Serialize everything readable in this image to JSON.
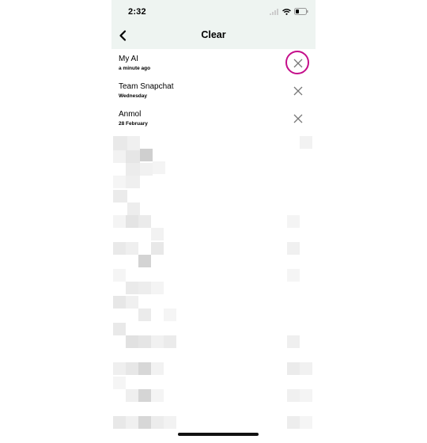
{
  "status_bar": {
    "time": "2:32"
  },
  "header": {
    "title": "Clear"
  },
  "chats": [
    {
      "name": "My AI",
      "time": "a minute ago"
    },
    {
      "name": "Team Snapchat",
      "time": "Wednesday"
    },
    {
      "name": "Anmol",
      "time": "28 February"
    }
  ],
  "colors": {
    "header_bg": "#eef4f1",
    "highlight_ring": "#c40e8a"
  }
}
